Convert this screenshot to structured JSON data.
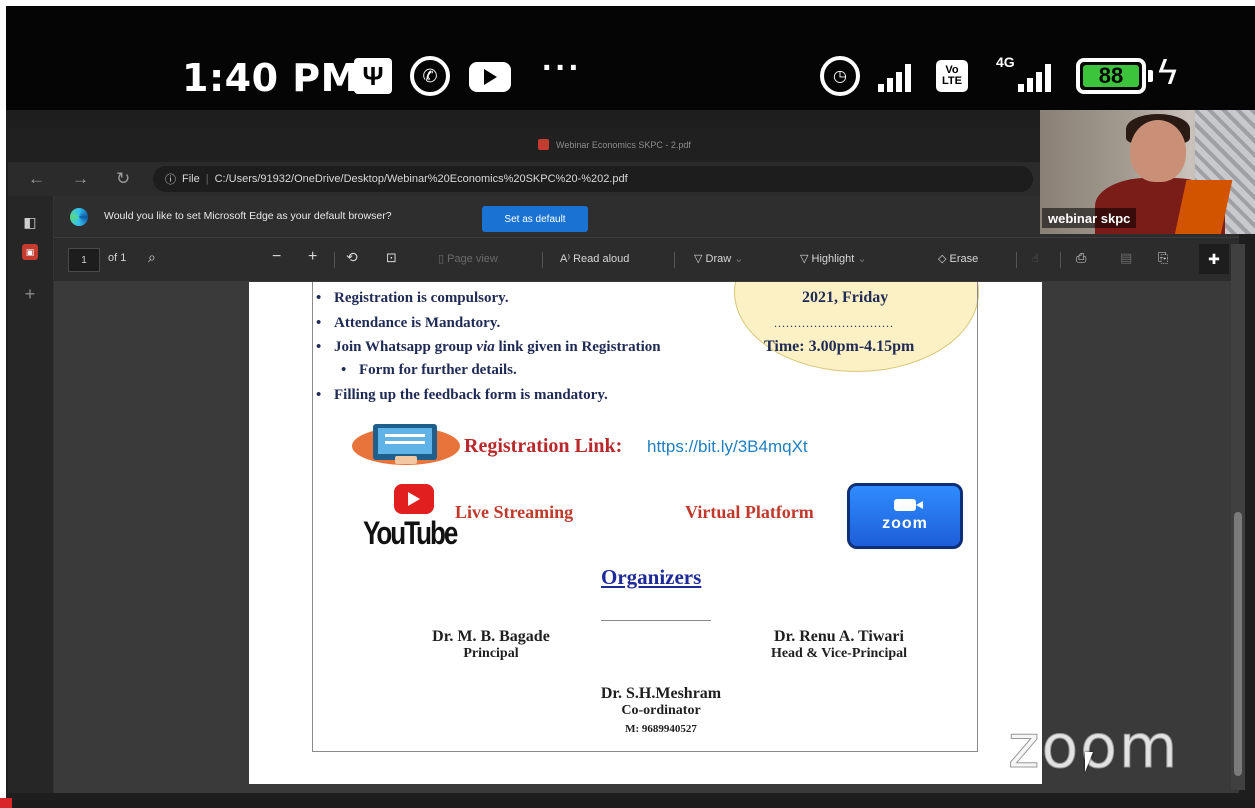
{
  "status_bar": {
    "time": "1:40 PM",
    "more": "···",
    "network": "4G",
    "battery": "88",
    "volte": [
      "Vo",
      "LTE"
    ]
  },
  "browser": {
    "window_title": "Webinar Economics SKPC - 2.pdf",
    "address_prefix": "File",
    "url": "C:/Users/91932/OneDrive/Desktop/Webinar%20Economics%20SKPC%20-%202.pdf",
    "banner_text": "Would you like to set Microsoft Edge as your default browser?",
    "set_default_label": "Set as default"
  },
  "pdf_toolbar": {
    "page_number": "1",
    "page_total": "of 1",
    "page_view": "Page view",
    "read_aloud": "Read aloud",
    "draw": "Draw",
    "highlight": "Highlight",
    "erase": "Erase"
  },
  "document": {
    "bullets": [
      "Registration is compulsory.",
      "Attendance is Mandatory.",
      "Join Whatsapp group via link given in Registration",
      "Form for further details.",
      "Filling up the feedback form is mandatory."
    ],
    "date": "2021, Friday",
    "dots": "..............................",
    "time": "Time: 3.00pm-4.15pm",
    "registration_label": "Registration Link:",
    "registration_url": "https://bit.ly/3B4mqXt",
    "youtube_word": "YouTube",
    "live_streaming": "Live Streaming",
    "virtual_platform": "Virtual Platform",
    "zoom_logo_text": "zoom",
    "organizers_heading": "Organizers",
    "organizers": [
      {
        "name": "Dr. M. B. Bagade",
        "role": "Principal"
      },
      {
        "name": "Dr. Renu A. Tiwari",
        "role": "Head & Vice-Principal"
      },
      {
        "name": "Dr. S.H.Meshram",
        "role": "Co-ordinator",
        "phone": "M: 9689940527"
      }
    ]
  },
  "zoom": {
    "participant_name": "webinar skpc",
    "watermark": "zoom"
  },
  "colors": {
    "status_bar_bg": "#050505",
    "battery_fill": "#3cc43c",
    "edge_accent": "#1a73d2",
    "registration_red": "#b9282b",
    "link_blue": "#1f7fc1",
    "navy_text": "#1f2a55"
  }
}
